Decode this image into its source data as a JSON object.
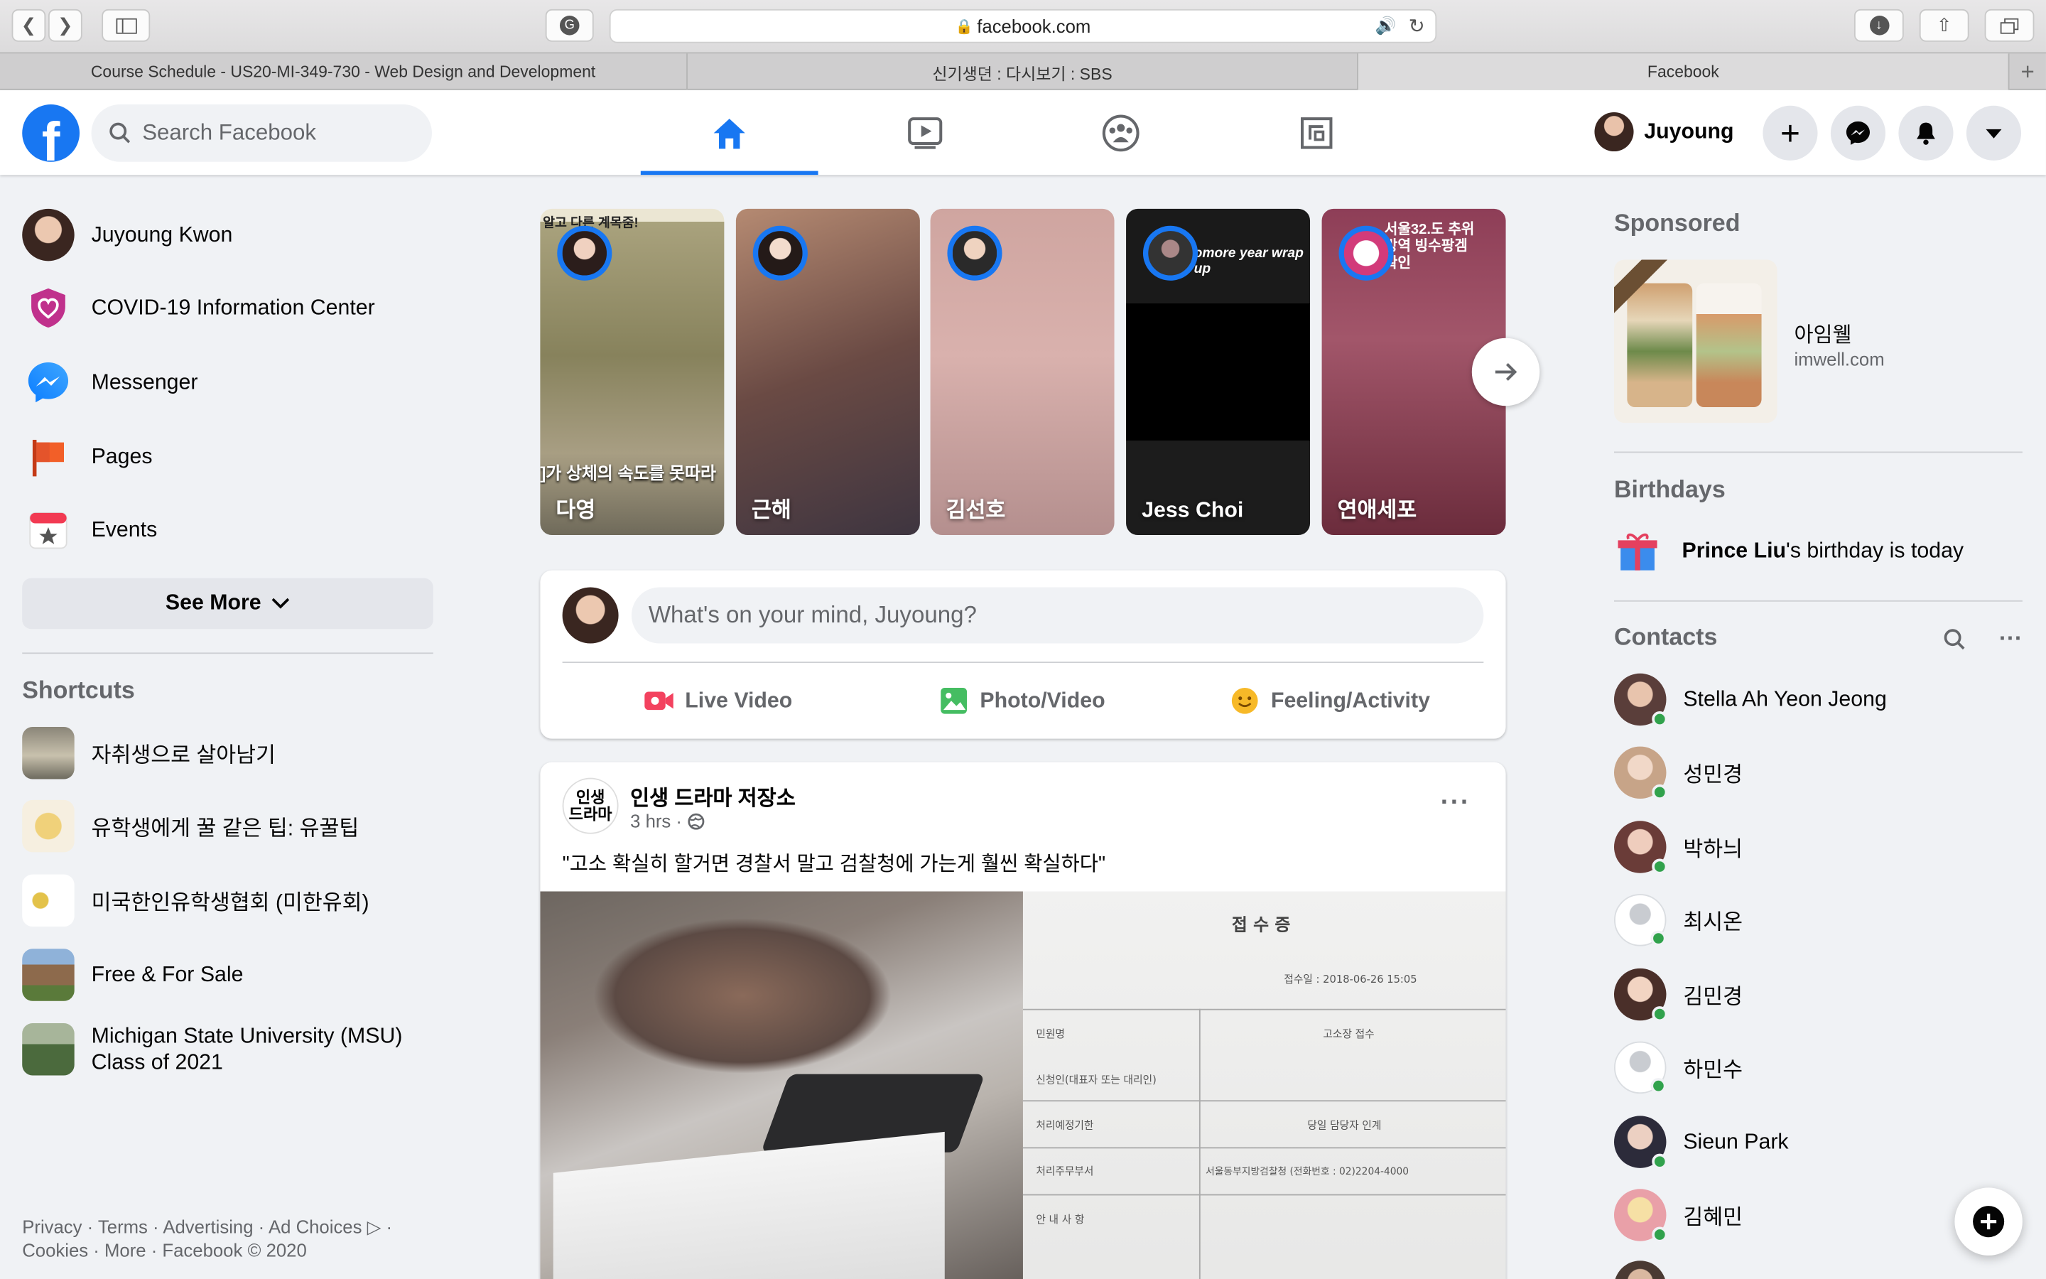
{
  "browser": {
    "url": "facebook.com",
    "tabs": [
      "Course Schedule - US20-MI-349-730 - Web Design and Development",
      "신기생뎐 : 다시보기 : SBS",
      "Facebook"
    ]
  },
  "header": {
    "search_placeholder": "Search Facebook",
    "user_name": "Juyoung",
    "nav": [
      "home-icon",
      "watch-icon",
      "groups-icon",
      "gaming-icon"
    ],
    "accent": "#1877f2"
  },
  "left": {
    "items": [
      {
        "label": "Juyoung Kwon",
        "icon": "avatar"
      },
      {
        "label": "COVID-19 Information Center",
        "icon": "covid-shield-icon"
      },
      {
        "label": "Messenger",
        "icon": "messenger-icon"
      },
      {
        "label": "Pages",
        "icon": "pages-flag-icon"
      },
      {
        "label": "Events",
        "icon": "events-calendar-icon"
      }
    ],
    "see_more": "See More",
    "shortcuts_title": "Shortcuts",
    "shortcuts": [
      "자취생으로 살아남기",
      "유학생에게 꿀 같은 팁: 유꿀팁",
      "미국한인유학생협회 (미한유회)",
      "Free & For Sale",
      "Michigan State University (MSU) Class of 2021"
    ],
    "footer": "Privacy · Terms · Advertising · Ad Choices ▷ · Cookies · More · Facebook © 2020"
  },
  "stories": [
    {
      "name": "다영",
      "overlay": "알고 다른 계목줌!",
      "caption": "]가 상체의 속도를 못따라"
    },
    {
      "name": "근해"
    },
    {
      "name": "김선호"
    },
    {
      "name": "Jess Choi",
      "overlay": "omore year wrap up"
    },
    {
      "name": "연애세포",
      "overlay": "서울32.도 추위방역 빙수팡겜 확인"
    }
  ],
  "composer": {
    "placeholder": "What's on your mind, Juyoung?",
    "actions": [
      "Live Video",
      "Photo/Video",
      "Feeling/Activity"
    ]
  },
  "post": {
    "page": "인생 드라마 저장소",
    "logo_text": "인생 드라마",
    "time": "3 hrs ·",
    "text": "\"고소 확실히 할거면 경찰서 말고 검찰청에 가는게 훨씬 확실하다\"",
    "doc_title": "접 수 증",
    "doc_rows": [
      "민원명",
      "신청인(대표자 또는 대리인)",
      "처리예정기한",
      "처리주무부서",
      "안 내 사 항"
    ],
    "doc_vals": [
      "고소장 접수",
      "당일 담당자 인계",
      "서울동부지방검찰청 (전화번호 : 02)2204-4000"
    ],
    "doc_date": "접수일 : 2018-06-26 15:05"
  },
  "right": {
    "sponsored_title": "Sponsored",
    "ad_name": "아임웰",
    "ad_url": "imwell.com",
    "birthdays_title": "Birthdays",
    "birthday_name": "Prince Liu",
    "birthday_text": "'s birthday is today",
    "contacts_title": "Contacts",
    "contacts": [
      "Stella Ah Yeon Jeong",
      "성민경",
      "박하늬",
      "최시온",
      "김민경",
      "하민수",
      "Sieun Park",
      "김혜민"
    ]
  }
}
